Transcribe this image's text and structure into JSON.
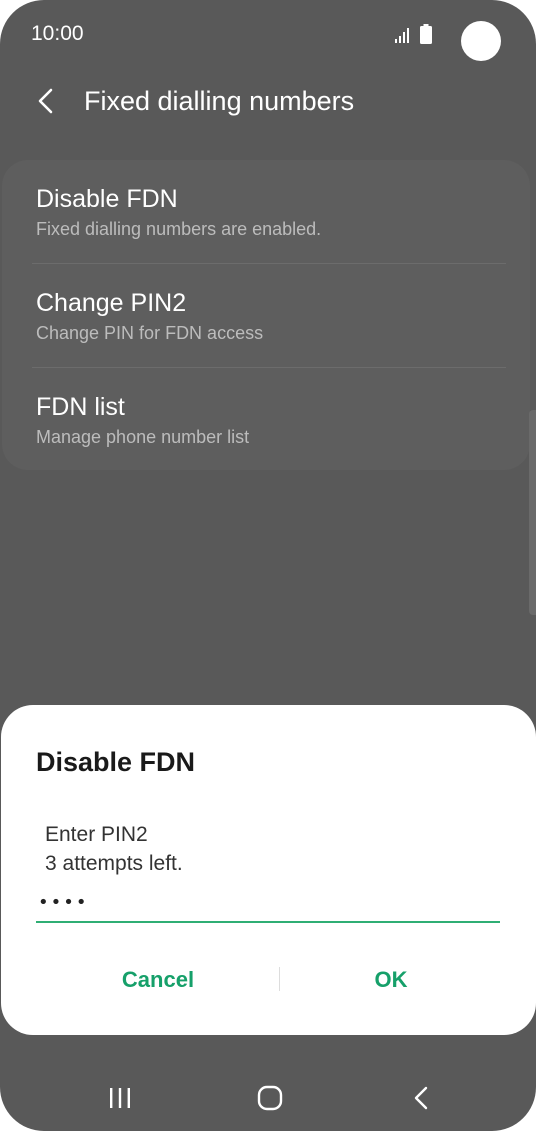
{
  "status_bar": {
    "time": "10:00",
    "icons": [
      "signal-icon",
      "battery-icon"
    ]
  },
  "header": {
    "back_icon": "chevron-left-icon",
    "title": "Fixed dialling numbers"
  },
  "settings": {
    "items": [
      {
        "title": "Disable FDN",
        "subtitle": "Fixed dialling numbers are enabled."
      },
      {
        "title": "Change PIN2",
        "subtitle": "Change PIN for FDN access"
      },
      {
        "title": "FDN list",
        "subtitle": "Manage phone number list"
      }
    ]
  },
  "dialog": {
    "title": "Disable FDN",
    "message_line1": "Enter PIN2",
    "message_line2": "3 attempts left.",
    "pin_value": "••••",
    "cancel_label": "Cancel",
    "ok_label": "OK"
  },
  "nav_bar": {
    "icons": [
      "recents-icon",
      "home-icon",
      "back-icon"
    ]
  },
  "colors": {
    "accent": "#16a06a",
    "dim_background": "#595959",
    "dialog_background": "#ffffff"
  }
}
